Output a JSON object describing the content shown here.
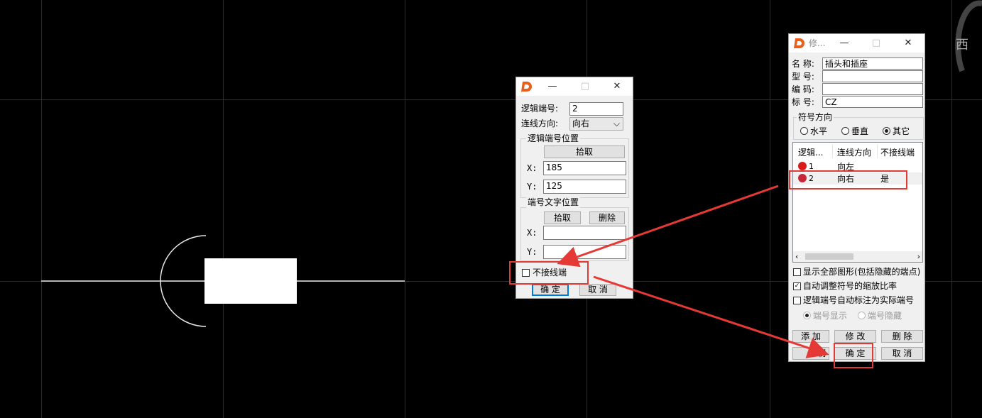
{
  "canvas": {
    "compass_label": "西"
  },
  "dlg_left": {
    "logic_no_label": "逻辑端号:",
    "logic_no_value": "2",
    "direction_label": "连线方向:",
    "direction_value": "向右",
    "pos_group_title": "逻辑端号位置",
    "pick_label": "拾取",
    "x_label": "X:",
    "x_value": "185",
    "y_label": "Y:",
    "y_value": "125",
    "text_group_title": "端号文字位置",
    "pick2_label": "拾取",
    "delete_label": "删除",
    "x2_label": "X:",
    "y2_label": "Y:",
    "no_connect_label": "不接线端",
    "ok_label": "确  定",
    "cancel_label": "取  消"
  },
  "dlg_right": {
    "title": "修...",
    "name_label": "名 称:",
    "name_value": "插头和插座",
    "model_label": "型 号:",
    "model_value": "",
    "code_label": "编 码:",
    "code_value": "",
    "tag_label": "标 号:",
    "tag_value": "CZ",
    "dir_group_title": "符号方向",
    "radio_h": "水平",
    "radio_v": "垂直",
    "radio_o": "其它",
    "columns": [
      "逻辑...",
      "连线方向",
      "不接线端"
    ],
    "rows": [
      {
        "no": "1",
        "dir": "向左",
        "nc": ""
      },
      {
        "no": "2",
        "dir": "向右",
        "nc": "是"
      }
    ],
    "show_all_label": "显示全部图形(包括隐藏的端点)",
    "auto_scale_label": "自动调整符号的缩放比率",
    "auto_tag_label": "逻辑端号自动标注为实际端号",
    "show_no_label": "端号显示",
    "hide_no_label": "端号隐藏",
    "add_label": "添 加",
    "edit_label": "修 改",
    "remove_label": "删 除",
    "copy_label": "制",
    "ok_label": "确 定",
    "cancel_label": "取 消"
  },
  "colors": {
    "highlight": "#e53935",
    "logo": "#e8601c",
    "pin_dot": "#c62828"
  }
}
